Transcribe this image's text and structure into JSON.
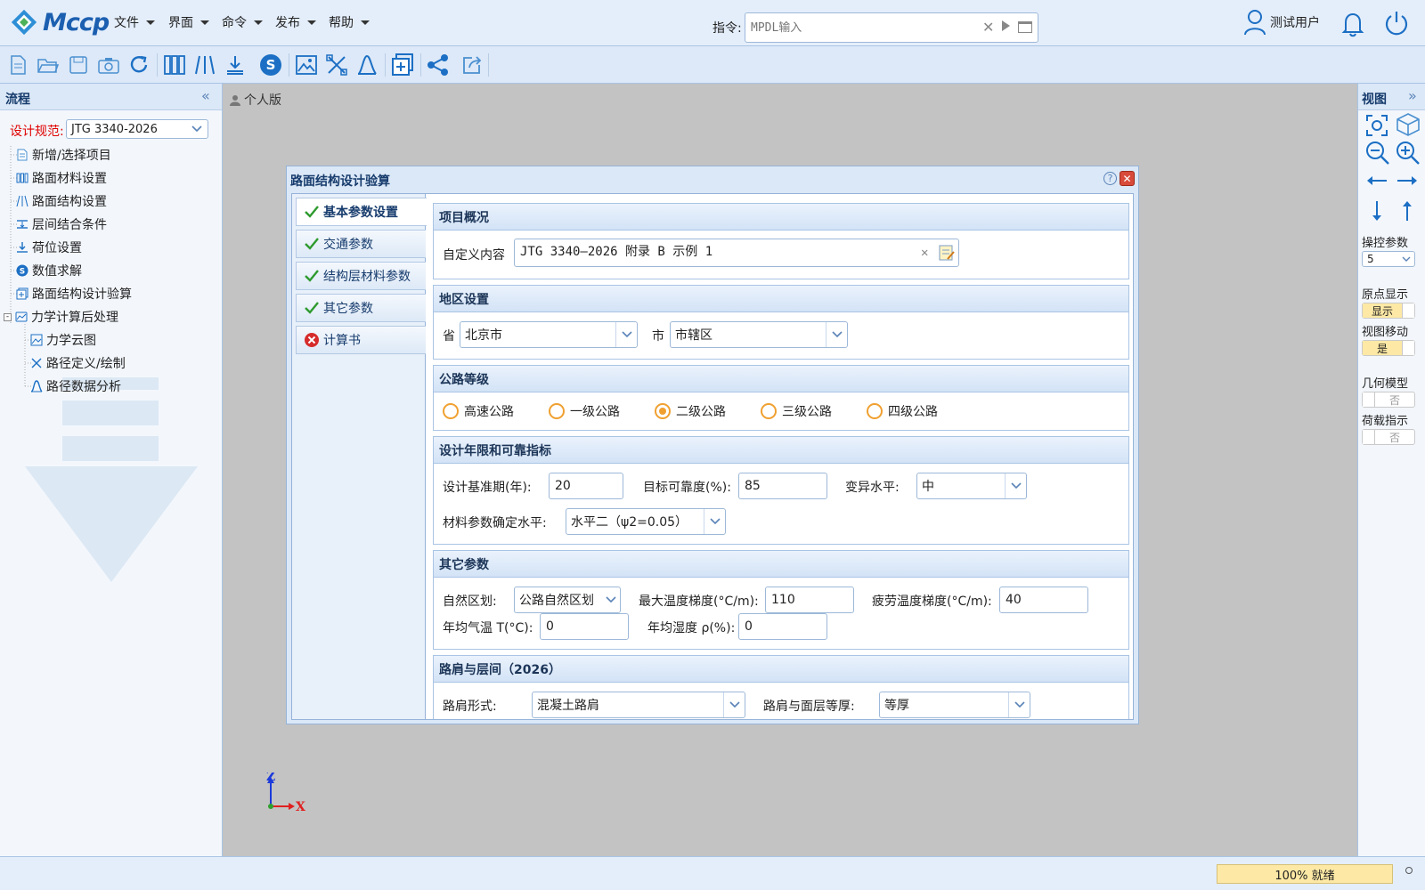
{
  "app": {
    "logo_text": "Mccp"
  },
  "menus": [
    {
      "label": "文件"
    },
    {
      "label": "界面"
    },
    {
      "label": "命令"
    },
    {
      "label": "发布"
    },
    {
      "label": "帮助"
    }
  ],
  "command": {
    "label": "指令:",
    "placeholder": "MPDL输入"
  },
  "user": {
    "name": "测试用户"
  },
  "left_panel": {
    "title": "流程",
    "spec_label": "设计规范:",
    "spec_value": "JTG 3340-2026",
    "tree": [
      {
        "label": "新增/选择项目",
        "icon": "document-icon"
      },
      {
        "label": "路面材料设置",
        "icon": "material-icon"
      },
      {
        "label": "路面结构设置",
        "icon": "structure-icon"
      },
      {
        "label": "层间结合条件",
        "icon": "interlayer-icon"
      },
      {
        "label": "荷位设置",
        "icon": "load-icon"
      },
      {
        "label": "数值求解",
        "icon": "solve-icon"
      },
      {
        "label": "路面结构设计验算",
        "icon": "verify-icon"
      },
      {
        "label": "力学计算后处理",
        "icon": "postprocess-icon"
      },
      {
        "label": "力学云图",
        "icon": "cloud-map-icon"
      },
      {
        "label": "路径定义/绘制",
        "icon": "path-define-icon"
      },
      {
        "label": "路径数据分析",
        "icon": "path-analysis-icon"
      }
    ]
  },
  "center": {
    "edition": "个人版"
  },
  "right_panel": {
    "title": "视图",
    "control_param_label": "操控参数",
    "control_param_value": "5",
    "origin_label": "原点显示",
    "origin_value": "显示",
    "view_move_label": "视图移动",
    "view_move_value": "是",
    "geometry_label": "几何模型",
    "geometry_value": "否",
    "load_label": "荷载指示",
    "load_value": "否"
  },
  "status": {
    "progress_text": "100% 就绪",
    "progress_fraction": 1.0
  },
  "dialog": {
    "title": "路面结构设计验算",
    "tabs": [
      {
        "label": "基本参数设置",
        "status": "ok"
      },
      {
        "label": "交通参数",
        "status": "ok"
      },
      {
        "label": "结构层材料参数",
        "status": "ok"
      },
      {
        "label": "其它参数",
        "status": "ok"
      },
      {
        "label": "计算书",
        "status": "error"
      }
    ],
    "project": {
      "title": "项目概况",
      "custom_label": "自定义内容",
      "custom_value": "JTG 3340—2026 附录 B 示例 1"
    },
    "region": {
      "title": "地区设置",
      "province_label": "省",
      "province_value": "北京市",
      "city_label": "市",
      "city_value": "市辖区"
    },
    "grade": {
      "title": "公路等级",
      "options": [
        "高速公路",
        "一级公路",
        "二级公路",
        "三级公路",
        "四级公路"
      ],
      "selected": "二级公路"
    },
    "design": {
      "title": "设计年限和可靠指标",
      "period_label": "设计基准期(年):",
      "period_value": "20",
      "reliability_label": "目标可靠度(%):",
      "reliability_value": "85",
      "variation_label": "变异水平:",
      "variation_value": "中",
      "material_label": "材料参数确定水平:",
      "material_value": "水平二（ψ2=0.05）"
    },
    "other": {
      "title": "其它参数",
      "zone_label": "自然区划:",
      "zone_value": "公路自然区划",
      "max_temp_label": "最大温度梯度(°C/m):",
      "max_temp_value": "110",
      "fatigue_label": "疲劳温度梯度(°C/m):",
      "fatigue_value": "40",
      "annual_temp_label": "年均气温 T(°C):",
      "annual_temp_value": "0",
      "humidity_label": "年均湿度 ρ(%):",
      "humidity_value": "0"
    },
    "shoulder": {
      "title": "路肩与层间（2026）",
      "form_label": "路肩形式:",
      "form_value": "混凝土路肩",
      "thickness_label": "路肩与面层等厚:",
      "thickness_value": "等厚"
    }
  },
  "axes": {
    "z": "Z",
    "x": "X"
  },
  "colors": {
    "accent": "#1c5fb0",
    "selected_radio": "#f0a030",
    "ok": "#2e9a2e",
    "error": "#d62b2b"
  }
}
